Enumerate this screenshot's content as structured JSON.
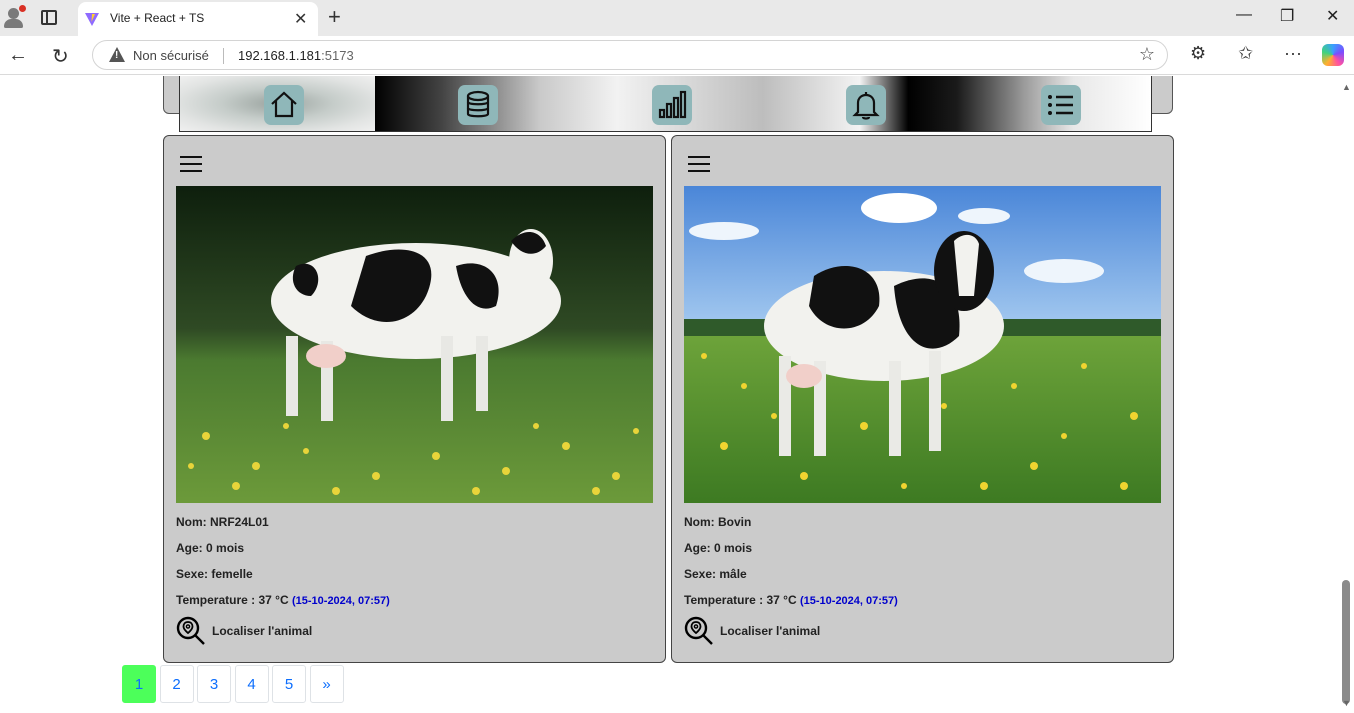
{
  "browser": {
    "tab_title": "Vite + React + TS",
    "security_label": "Non sécurisé",
    "url_host": "192.168.1.181",
    "url_port": ":5173"
  },
  "nav_icons": [
    "home-icon",
    "database-icon",
    "chart-icon",
    "bell-icon",
    "list-icon"
  ],
  "cards": [
    {
      "nom_label": "Nom:",
      "nom": "NRF24L01",
      "age_label": "Age:",
      "age": "0 mois",
      "sexe_label": "Sexe:",
      "sexe": "femelle",
      "temp_label": "Temperature :",
      "temp": "37 °C",
      "timestamp": "(15-10-2024, 07:57)",
      "locate_label": "Localiser l'animal"
    },
    {
      "nom_label": "Nom:",
      "nom": "Bovin",
      "age_label": "Age:",
      "age": "0 mois",
      "sexe_label": "Sexe:",
      "sexe": "mâle",
      "temp_label": "Temperature :",
      "temp": "37 °C",
      "timestamp": "(15-10-2024, 07:57)",
      "locate_label": "Localiser l'animal"
    }
  ],
  "pagination": {
    "pages": [
      "1",
      "2",
      "3",
      "4",
      "5"
    ],
    "next": "»",
    "active": "1"
  },
  "colors": {
    "accent_active_page": "#4cff5a",
    "link_blue": "#0d6efd",
    "timestamp_blue": "#0000cc",
    "nav_button": "#8fb7b9"
  }
}
